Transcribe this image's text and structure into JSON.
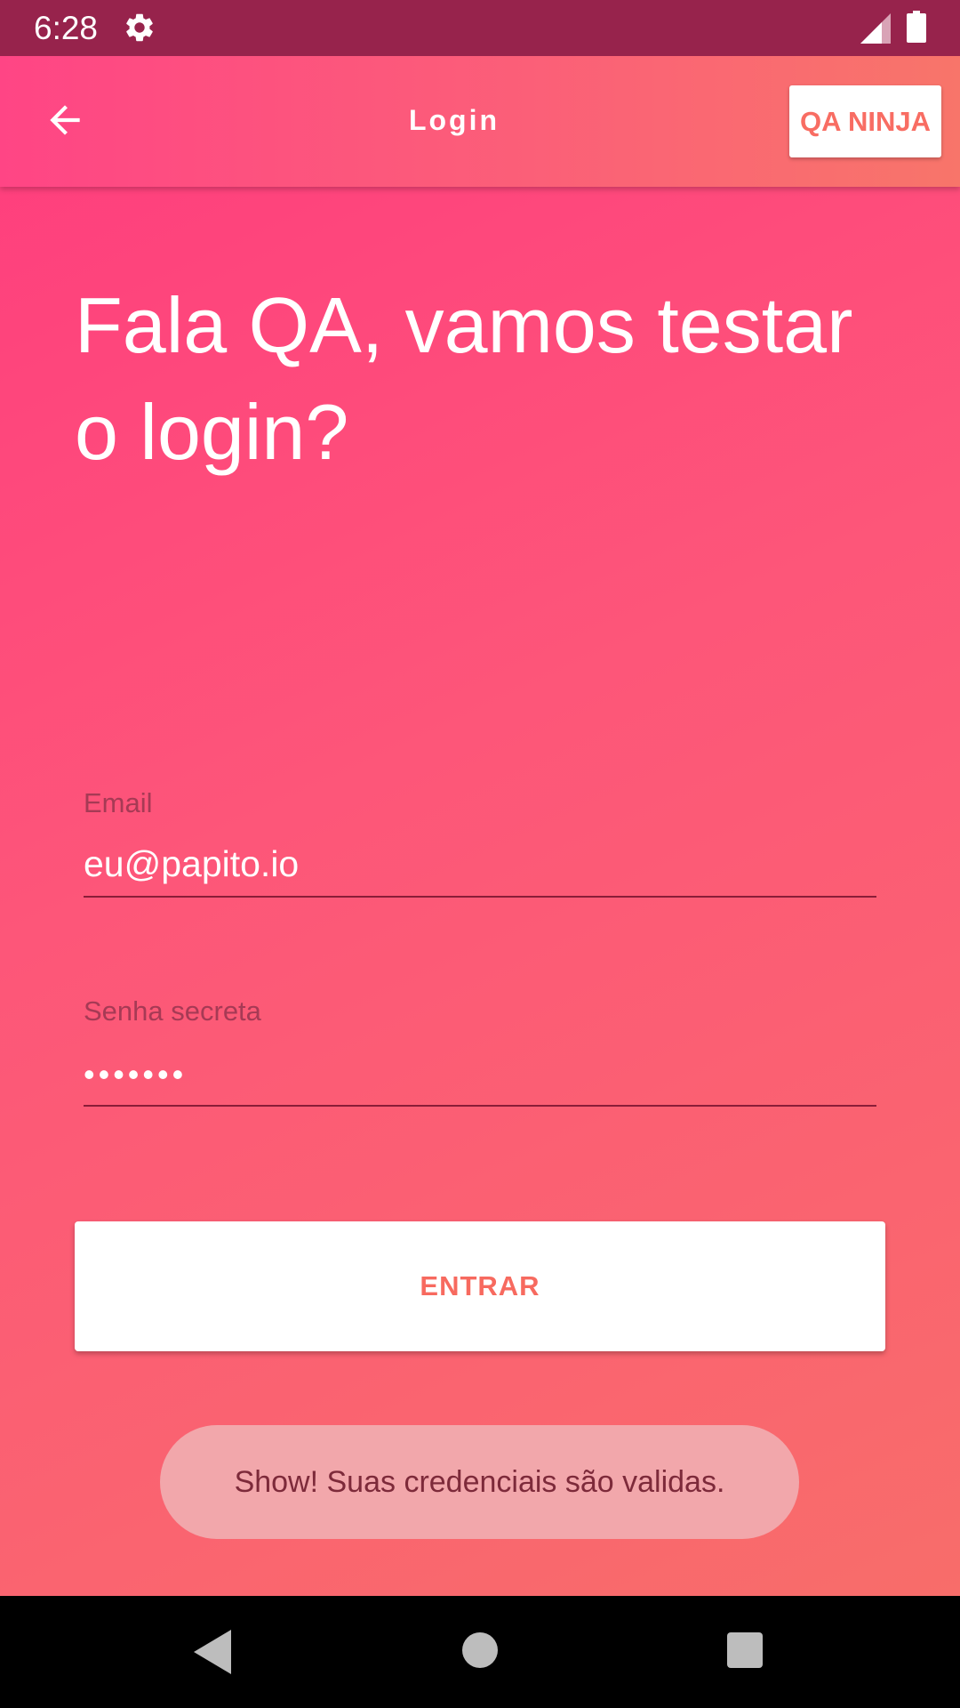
{
  "status_bar": {
    "time": "6:28",
    "icons": [
      "gear-icon",
      "cell-signal-icon",
      "battery-icon"
    ]
  },
  "app_bar": {
    "back_icon": "arrow-back-icon",
    "title": "Login",
    "action_label": "QA NINJA"
  },
  "headline": "Fala QA, vamos testar o login?",
  "form": {
    "email": {
      "label": "Email",
      "value": "eu@papito.io"
    },
    "password": {
      "label": "Senha secreta",
      "value": "•••••••"
    },
    "submit_label": "ENTRAR"
  },
  "toast": {
    "message": "Show! Suas credenciais são validas."
  },
  "nav_bar": {
    "icons": [
      "nav-back-icon",
      "nav-home-icon",
      "nav-recents-icon"
    ]
  },
  "colors": {
    "status_bar": "#97234c",
    "gradient_start": "#ff3c7e",
    "gradient_end": "#f86d6a",
    "accent_text": "#f76a5f",
    "toast_bg": "#f2a7ab"
  }
}
